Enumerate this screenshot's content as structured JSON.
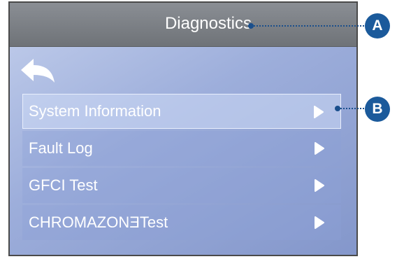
{
  "header": {
    "title": "Diagnostics"
  },
  "icons": {
    "back": "back-arrow-icon",
    "row_arrow": "play-arrow-icon"
  },
  "menu": {
    "items": [
      {
        "label": "System Information",
        "selected": true
      },
      {
        "label": "Fault Log",
        "selected": false
      },
      {
        "label": "GFCI Test",
        "selected": false
      },
      {
        "label": "CHROMAZONƎTest",
        "selected": false
      }
    ]
  },
  "callouts": [
    {
      "letter": "A"
    },
    {
      "letter": "B"
    }
  ],
  "colors": {
    "accent": "#1b5a9b",
    "titlebar": "#7a7e84",
    "background": "#9daedb"
  }
}
